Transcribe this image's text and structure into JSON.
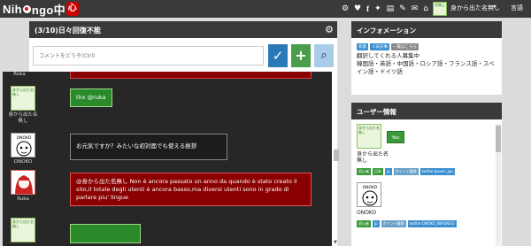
{
  "app": {
    "logo_text": "Nihongo中",
    "logo_text_suffix": "ngo中",
    "logo_prefix": "Nih",
    "logo_kanji": "心"
  },
  "topbar": {
    "icons": [
      "gear-icon",
      "heart-icon",
      "facebook-icon",
      "twitter-icon",
      "book-icon",
      "brush-icon",
      "chat-icon",
      "home-icon"
    ],
    "user_name": "身から出た名無し",
    "user_avatar_text": "名無し",
    "language": "言語"
  },
  "chat": {
    "title": "(3/10)日々回復不能",
    "compose_placeholder": "コメントをどうぞ(Ctrl)"
  },
  "messages": [
    {
      "author": "Ruka",
      "text": ""
    },
    {
      "author": "身から出た名無し",
      "avatar_text": "身から出た名無し",
      "text": "thx @ruka",
      "style": "green"
    },
    {
      "author": "ONOKO",
      "avatar_text": "ONOKO",
      "text": "お元気ですか？みたいな初対面でも使える挨拶",
      "style": "black"
    },
    {
      "author": "Ruka",
      "text": "@身から出た名無し Non è ancora passato un anno da quando è stato creato il sito,il totale degli utenti è ancora basso,ma diversi utenti sono in grado di parlare piu' lingue",
      "style": "red"
    },
    {
      "author": "身から出た名無し",
      "avatar_text": "身から出た名無し",
      "text": "",
      "style": "green"
    }
  ],
  "info_panel": {
    "title": "インフォメーション",
    "tags": [
      "新着",
      "人気記事",
      "一覧はこちら"
    ],
    "lines": [
      "翻訳してくれる人募集中",
      "韓国語・英語・中国語・ロシア語・フランス語・スペイン語・ドイツ語"
    ]
  },
  "user_panel": {
    "title": "ユーザー情報",
    "users": [
      {
        "name": "身から出た名無し",
        "avatar_text": "身から出た名無し",
        "status": "Yes",
        "tags": [
          "初心者",
          "日本",
          "jp",
          "ポイント獲得",
          "twitter-guoen_jpp"
        ]
      },
      {
        "name": "ONOKO",
        "avatar_text": "ONOKO",
        "tags": [
          "初心者",
          "jp",
          "ポイント獲得",
          "twitter:ONOKO_NIHONGO"
        ]
      }
    ]
  },
  "colors": {
    "topbar": "#3a3a3a",
    "timeline_bg": "#272727",
    "send_button": "#2a7ab8",
    "add_button": "#4a9e4a",
    "attach_button": "#a9cde8",
    "bubble_red": "#8a0000",
    "bubble_green": "#2a8a2a"
  }
}
